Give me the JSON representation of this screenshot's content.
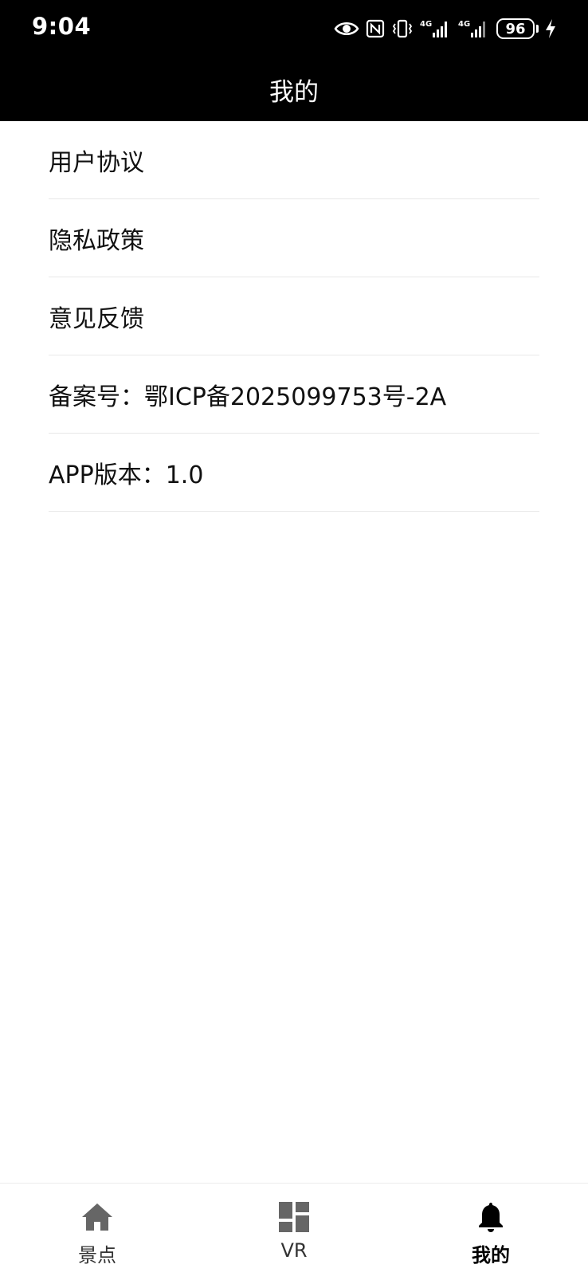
{
  "status_bar": {
    "time": "9:04",
    "battery_level": "96",
    "icons": [
      "eye-icon",
      "nfc-icon",
      "vibrate-icon",
      "signal-4g-icon",
      "signal-4g-icon",
      "battery-icon",
      "charging-icon"
    ]
  },
  "header": {
    "title": "我的"
  },
  "menu": {
    "items": [
      {
        "label": "用户协议"
      },
      {
        "label": "隐私政策"
      },
      {
        "label": "意见反馈"
      },
      {
        "label": "备案号：鄂ICP备2025099753号-2A"
      },
      {
        "label": "APP版本：1.0"
      }
    ]
  },
  "tab_bar": {
    "tabs": [
      {
        "label": "景点",
        "icon": "home-icon",
        "active": false
      },
      {
        "label": "VR",
        "icon": "dashboard-icon",
        "active": false
      },
      {
        "label": "我的",
        "icon": "bell-icon",
        "active": true
      }
    ]
  },
  "colors": {
    "header_bg": "#000000",
    "header_text": "#ffffff",
    "icon_inactive": "#666666",
    "icon_active": "#000000",
    "divider": "#e8e8e8"
  }
}
